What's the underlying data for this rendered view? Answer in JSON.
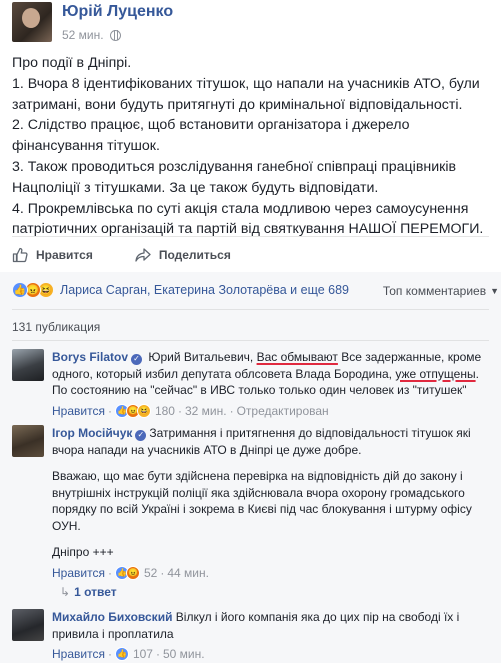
{
  "post": {
    "author": "Юрій Луценко",
    "time": "52 мин.",
    "body": [
      "Про події в Дніпрі.",
      "1. Вчора 8 ідентифікованих тітушок, що напали на учасників АТО, були затримані, вони будуть притягнуті до кримінальної відповідальності.",
      "2. Слідство працює, щоб встановити організатора і джерело фінансування тітушок.",
      "3. Також проводиться розслідування ганебної співпраці працівників Нацполіції з тітушками. За це також будуть відповідати.",
      "4. Прокремлівська по суті акція стала модливою через самоусунення патріотичних організацій та партій від святкування НАШОЇ ПЕРЕМОГИ."
    ]
  },
  "actions": {
    "like": "Нравится",
    "share": "Поделиться"
  },
  "reactions_summary": {
    "names": "Лариса Сарган, Екатерина Золотарёва и еще 689",
    "sort_label": "Топ комментариев"
  },
  "publications_count": "131 публикация",
  "comments": [
    {
      "author": "Borys Filatov",
      "text_before": " Юрий Витальевич, ",
      "underline_1": "Вас обмывают",
      "text_middle": " Все задержанные, кроме одного, который избил депутата облсовета Влада Бородина, ",
      "underline_2": "уже отпущены",
      "text_after": ". По состоянию на \"сейчас\" в ИВС только только один человек из \"титушек\"",
      "like": "Нравится",
      "count": "180",
      "time": "32 мин.",
      "edited": "Отредактирован"
    },
    {
      "author": "Ігор Мосійчук",
      "paragraphs": [
        "Затримання і притягнення до відповідальності тітушок які вчора напади на учасників АТО в Дніпрі це дуже добре.",
        "Вважаю, що має бути здійснена перевірка на відповідність дій до закону і внутрішніх інструкцій поліції яка здійснювала вчора охорону громадського порядку по всій Україні і зокрема в Києві під час блокування і штурму офісу ОУН.",
        "Дніпро +++"
      ],
      "like": "Нравится",
      "count": "52",
      "time": "44 мин.",
      "reply_label": "1 ответ"
    },
    {
      "author": "Михайло Биховский",
      "text": " Вілкул і його компанія яка до цих пір на свободі їх і привила і проплатила",
      "like": "Нравится",
      "count": "107",
      "time": "50 мин."
    }
  ],
  "colors": {
    "link": "#365899",
    "like_blue": "#5890ff",
    "angry_orange": "#e9710f",
    "haha_yellow": "#f7b125",
    "underline_red": "#e0293f"
  }
}
